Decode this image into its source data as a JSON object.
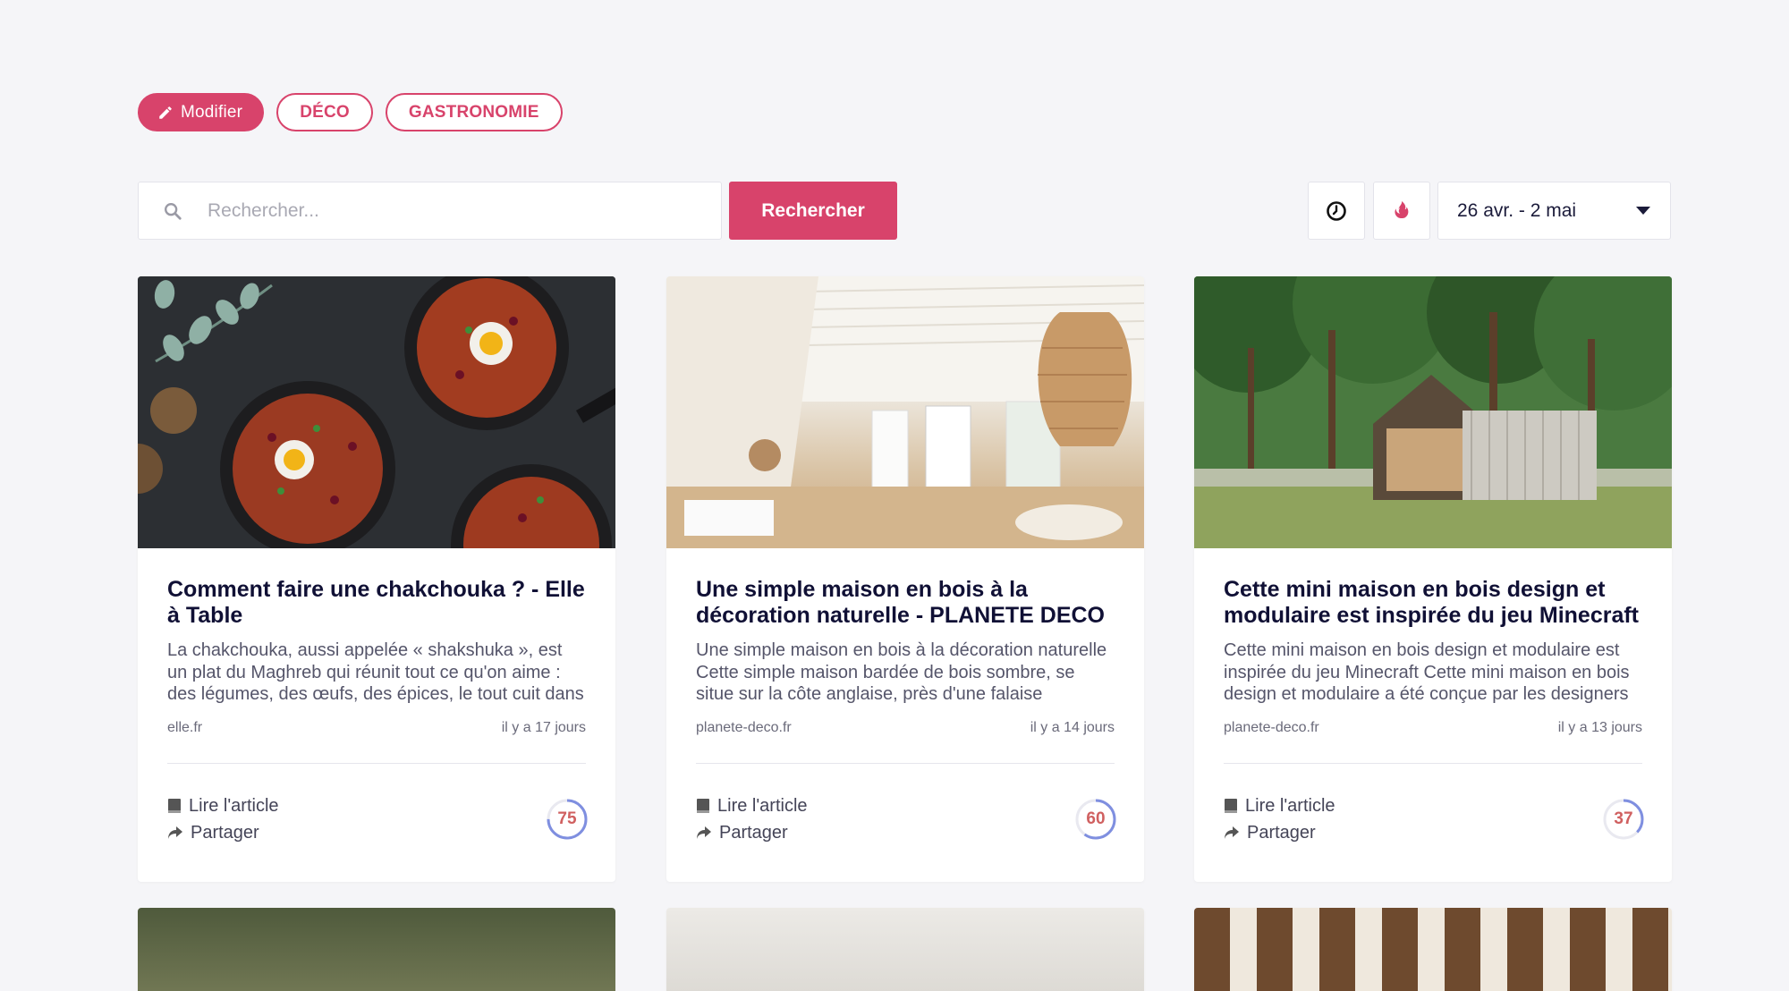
{
  "tags": [
    {
      "label": "Modifier",
      "primary": true
    },
    {
      "label": "DÉCO",
      "primary": false
    },
    {
      "label": "GASTRONOMIE",
      "primary": false
    }
  ],
  "search": {
    "placeholder": "Rechercher...",
    "button_label": "Rechercher"
  },
  "date_filter": {
    "value": "26 avr. - 2 mai"
  },
  "accent_color": "#d8436b",
  "cards": [
    {
      "title": "Comment faire une chakchouka ? - Elle à Table",
      "description": "La chakchouka, aussi appelée « shakshuka », est un plat du Maghreb qui réunit tout ce qu'on aime : des légumes, des œufs, des épices, le tout cuit dans la…",
      "source": "elle.fr",
      "age": "il y a 17 jours",
      "read_label": "Lire l'article",
      "share_label": "Partager",
      "score": 75
    },
    {
      "title": "Une simple maison en bois à la décoration naturelle - PLANETE DECO a homes world",
      "description": "Une simple maison en bois à la décoration naturelle Cette simple maison bardée de bois sombre, se situe sur la côte anglaise, près d'une falaise",
      "source": "planete-deco.fr",
      "age": "il y a 14 jours",
      "read_label": "Lire l'article",
      "share_label": "Partager",
      "score": 60
    },
    {
      "title": "Cette mini maison en bois design et modulaire est inspirée du jeu Minecraft -…",
      "description": "Cette mini maison en bois design et modulaire est inspirée du jeu Minecraft Cette mini maison en bois design et modulaire a été conçue par les designers",
      "source": "planete-deco.fr",
      "age": "il y a 13 jours",
      "read_label": "Lire l'article",
      "share_label": "Partager",
      "score": 37
    }
  ]
}
